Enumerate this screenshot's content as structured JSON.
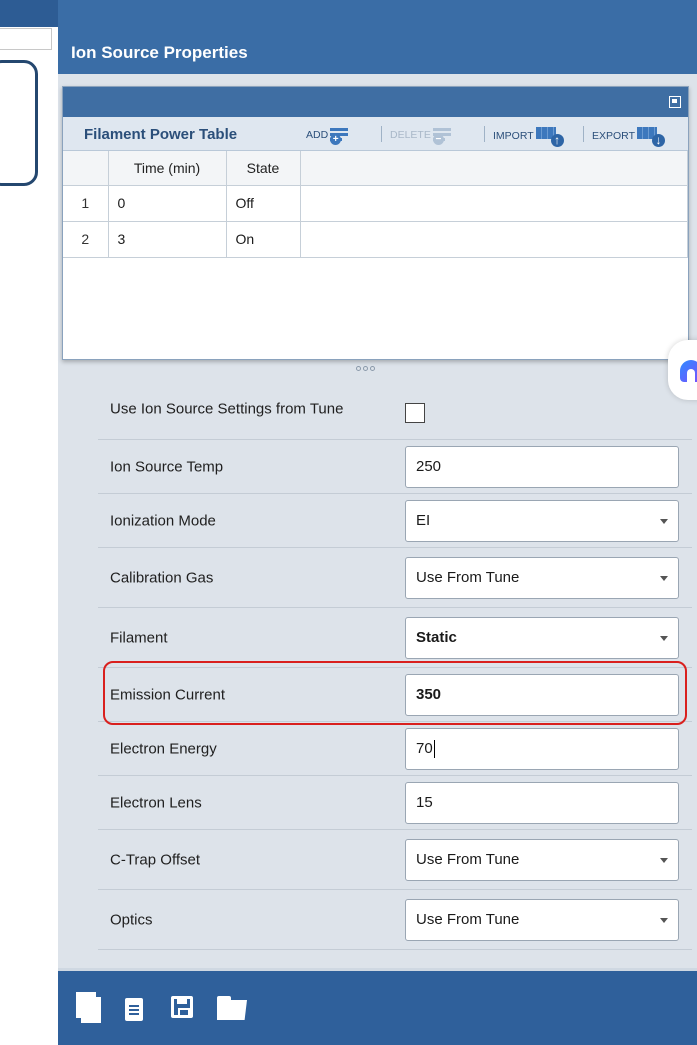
{
  "panel": {
    "title": "Ion Source Properties"
  },
  "filament_table": {
    "title": "Filament Power Table",
    "toolbar": {
      "add": "ADD",
      "delete": "DELETE",
      "import": "IMPORT",
      "export": "EXPORT"
    },
    "columns": [
      "Time (min)",
      "State"
    ],
    "rows": [
      {
        "index": "1",
        "time": "0",
        "state": "Off"
      },
      {
        "index": "2",
        "time": "3",
        "state": "On"
      }
    ]
  },
  "properties": {
    "use_tune": {
      "label": "Use Ion Source Settings from Tune",
      "checked": false
    },
    "source_temp": {
      "label": "Ion Source Temp",
      "value": "250"
    },
    "ionization_mode": {
      "label": "Ionization Mode",
      "value": "EI"
    },
    "calibration_gas": {
      "label": "Calibration Gas",
      "value": "Use From Tune"
    },
    "filament": {
      "label": "Filament",
      "value": "Static"
    },
    "emission_current": {
      "label": "Emission Current",
      "value": "350"
    },
    "electron_energy": {
      "label": "Electron Energy",
      "value": "70"
    },
    "electron_lens": {
      "label": "Electron Lens",
      "value": "15"
    },
    "c_trap_offset": {
      "label": "C-Trap Offset",
      "value": "Use From Tune"
    },
    "optics": {
      "label": "Optics",
      "value": "Use From Tune"
    }
  },
  "bottom_toolbar": {
    "icons": [
      "copy-icon",
      "clipboard-icon",
      "save-icon",
      "open-folder-icon"
    ]
  },
  "colors": {
    "header_blue": "#3a6da6",
    "highlight_red": "#d9201e",
    "panel_bg": "#dde3ea"
  }
}
